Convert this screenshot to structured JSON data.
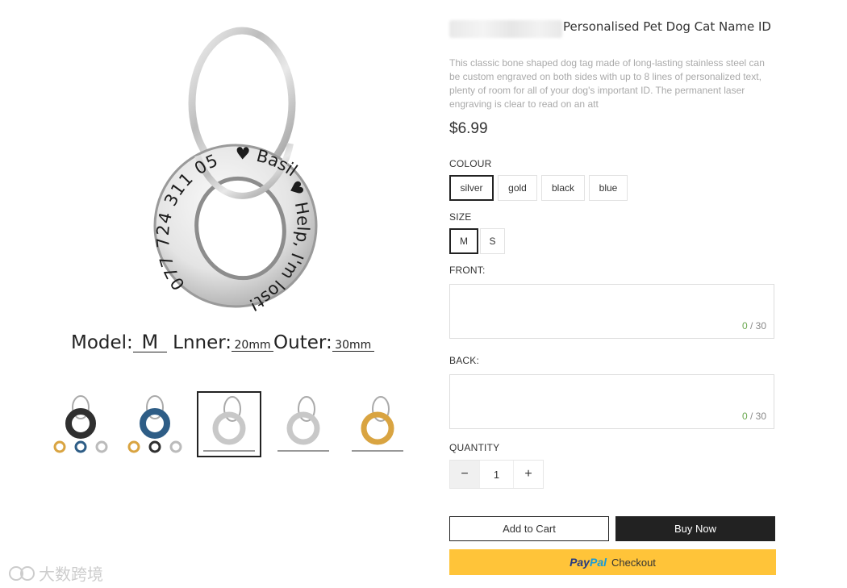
{
  "product": {
    "title": "Personalised Pet Dog Cat Name ID",
    "description": "This classic bone shaped dog tag made of long-lasting stainless steel can be custom engraved on both sides with up to 8 lines of personalized text, plenty of room for all of your dog's important ID. The permanent laser engraving is clear to read on an att",
    "price": "$6.99"
  },
  "image": {
    "engraving_outer": "077 724 311 05",
    "engraving_name": "Basil",
    "engraving_msg": "Help, I'm lost!",
    "model_label": "Model:",
    "model_value": "M",
    "inner_label": "Lnner:",
    "inner_value": "20mm",
    "outer_label": "Outer:",
    "outer_value": "30mm"
  },
  "thumbnails": [
    {
      "color": "#2f2f2f",
      "name": "black"
    },
    {
      "color": "#2e5d86",
      "name": "blue"
    },
    {
      "color": "#c8c8c8",
      "name": "silver",
      "active": true
    },
    {
      "color": "#c8c8c8",
      "name": "silver"
    },
    {
      "color": "#d9a441",
      "name": "gold"
    }
  ],
  "colour": {
    "label": "COLOUR",
    "options": [
      "silver",
      "gold",
      "black",
      "blue"
    ],
    "selected": "silver"
  },
  "size": {
    "label": "SIZE",
    "options": [
      "M",
      "S"
    ],
    "selected": "M"
  },
  "front": {
    "label": "FRONT:",
    "count": "0",
    "max": "30"
  },
  "back": {
    "label": "BACK:",
    "count": "0",
    "max": "30"
  },
  "quantity": {
    "label": "QUANTITY",
    "value": "1",
    "minus": "−",
    "plus": "+"
  },
  "actions": {
    "add_to_cart": "Add to Cart",
    "buy_now": "Buy Now",
    "paypal_pay": "Pay",
    "paypal_pal": "Pal",
    "paypal_checkout": "Checkout"
  },
  "watermark": "大数跨境",
  "colors": {
    "paypal_bg": "#ffc439",
    "buy_now_bg": "#222222",
    "counter_green": "#6aa84f"
  }
}
